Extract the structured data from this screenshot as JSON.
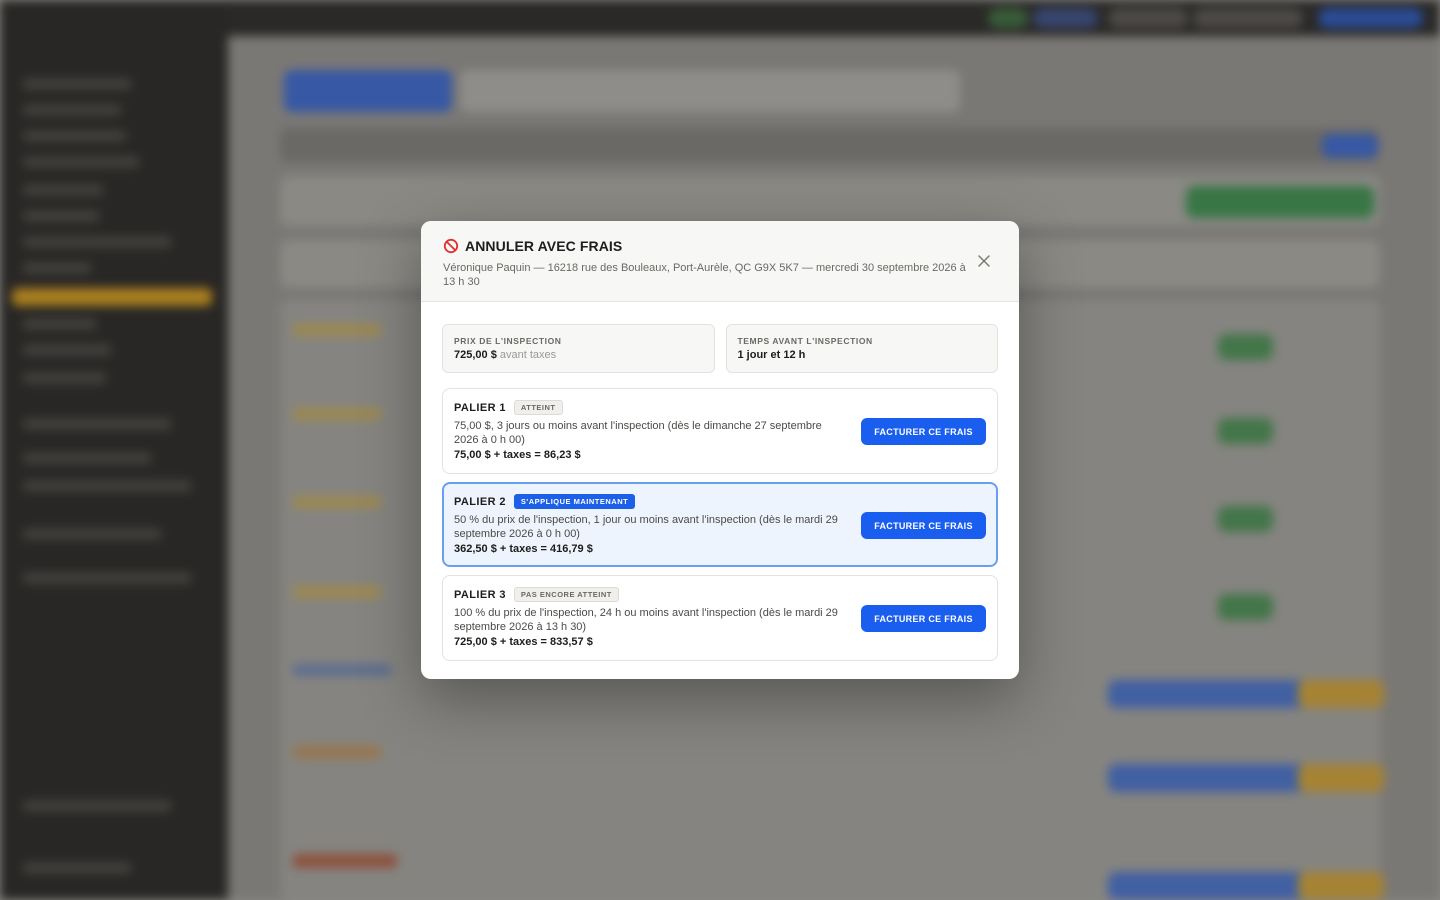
{
  "modal": {
    "icon": "ban-icon",
    "title": "ANNULER AVEC FRAIS",
    "subtitle": "Véronique Paquin — 16218 rue des Bouleaux, Port-Aurèle, QC G9X 5K7 — mercredi 30 septembre 2026 à 13 h 30",
    "close_icon": "close-icon",
    "info": {
      "price_label": "PRIX DE L'INSPECTION",
      "price_value": "725,00 $",
      "price_suffix": "avant taxes",
      "time_label": "TEMPS AVANT L'INSPECTION",
      "time_value": "1 jour et 12 h"
    },
    "tiers": [
      {
        "name": "PALIER 1",
        "badge": "ATTEINT",
        "description": "75,00 $, 3 jours ou moins avant l'inspection (dès le dimanche 27 septembre 2026 à 0 h 00)",
        "total": "75,00 $ + taxes = 86,23 $",
        "button": "FACTURER CE FRAIS"
      },
      {
        "name": "PALIER 2",
        "badge": "S'APPLIQUE MAINTENANT",
        "description": "50 % du prix de l'inspection, 1 jour ou moins avant l'inspection (dès le mardi 29 septembre 2026 à 0 h 00)",
        "total": "362,50 $ + taxes = 416,79 $",
        "button": "FACTURER CE FRAIS"
      },
      {
        "name": "PALIER 3",
        "badge": "PAS ENCORE ATTEINT",
        "description": "100 % du prix de l'inspection, 24 h ou moins avant l'inspection (dès le mardi 29 septembre 2026 à 13 h 30)",
        "total": "725,00 $ + taxes = 833,57 $",
        "button": "FACTURER CE FRAIS"
      }
    ]
  },
  "colors": {
    "accent": "#1a5ef0",
    "danger": "#e03131",
    "current_tier_bg": "#eef4fe"
  }
}
